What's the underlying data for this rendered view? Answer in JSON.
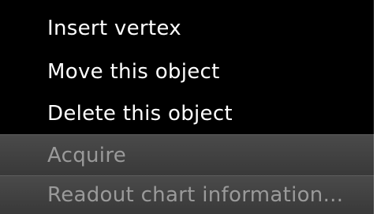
{
  "context_menu": {
    "items": [
      {
        "label": "Insert vertex",
        "enabled": true
      },
      {
        "label": "Move this object",
        "enabled": true
      },
      {
        "label": "Delete this object",
        "enabled": true
      },
      {
        "label": "Acquire",
        "enabled": false
      },
      {
        "label": "Readout chart information...",
        "enabled": false
      }
    ]
  },
  "colors": {
    "menu_background": "#000000",
    "enabled_text": "#ffffff",
    "disabled_text": "#9a9a9a",
    "disabled_background": "#3f3f3f"
  }
}
